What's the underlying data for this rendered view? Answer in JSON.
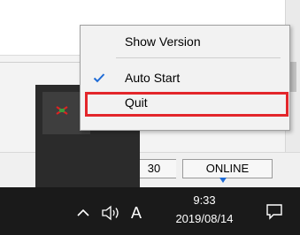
{
  "context_menu": {
    "items": [
      {
        "label": "Show Version",
        "checked": false
      },
      {
        "label": "Auto Start",
        "checked": true
      },
      {
        "label": "Quit",
        "checked": false,
        "highlighted": true
      }
    ]
  },
  "status_bar": {
    "number": "30",
    "connection": "ONLINE"
  },
  "taskbar": {
    "ime": "A",
    "time": "9:33",
    "date": "2019/08/14"
  },
  "icons": {
    "chevron": "chevron-up-icon",
    "volume": "volume-icon",
    "notification": "notification-icon",
    "app": "app-tray-icon"
  },
  "colors": {
    "highlight_border": "#e3262b",
    "check": "#1e6bd6",
    "taskbar_bg": "#1a1a1a"
  }
}
